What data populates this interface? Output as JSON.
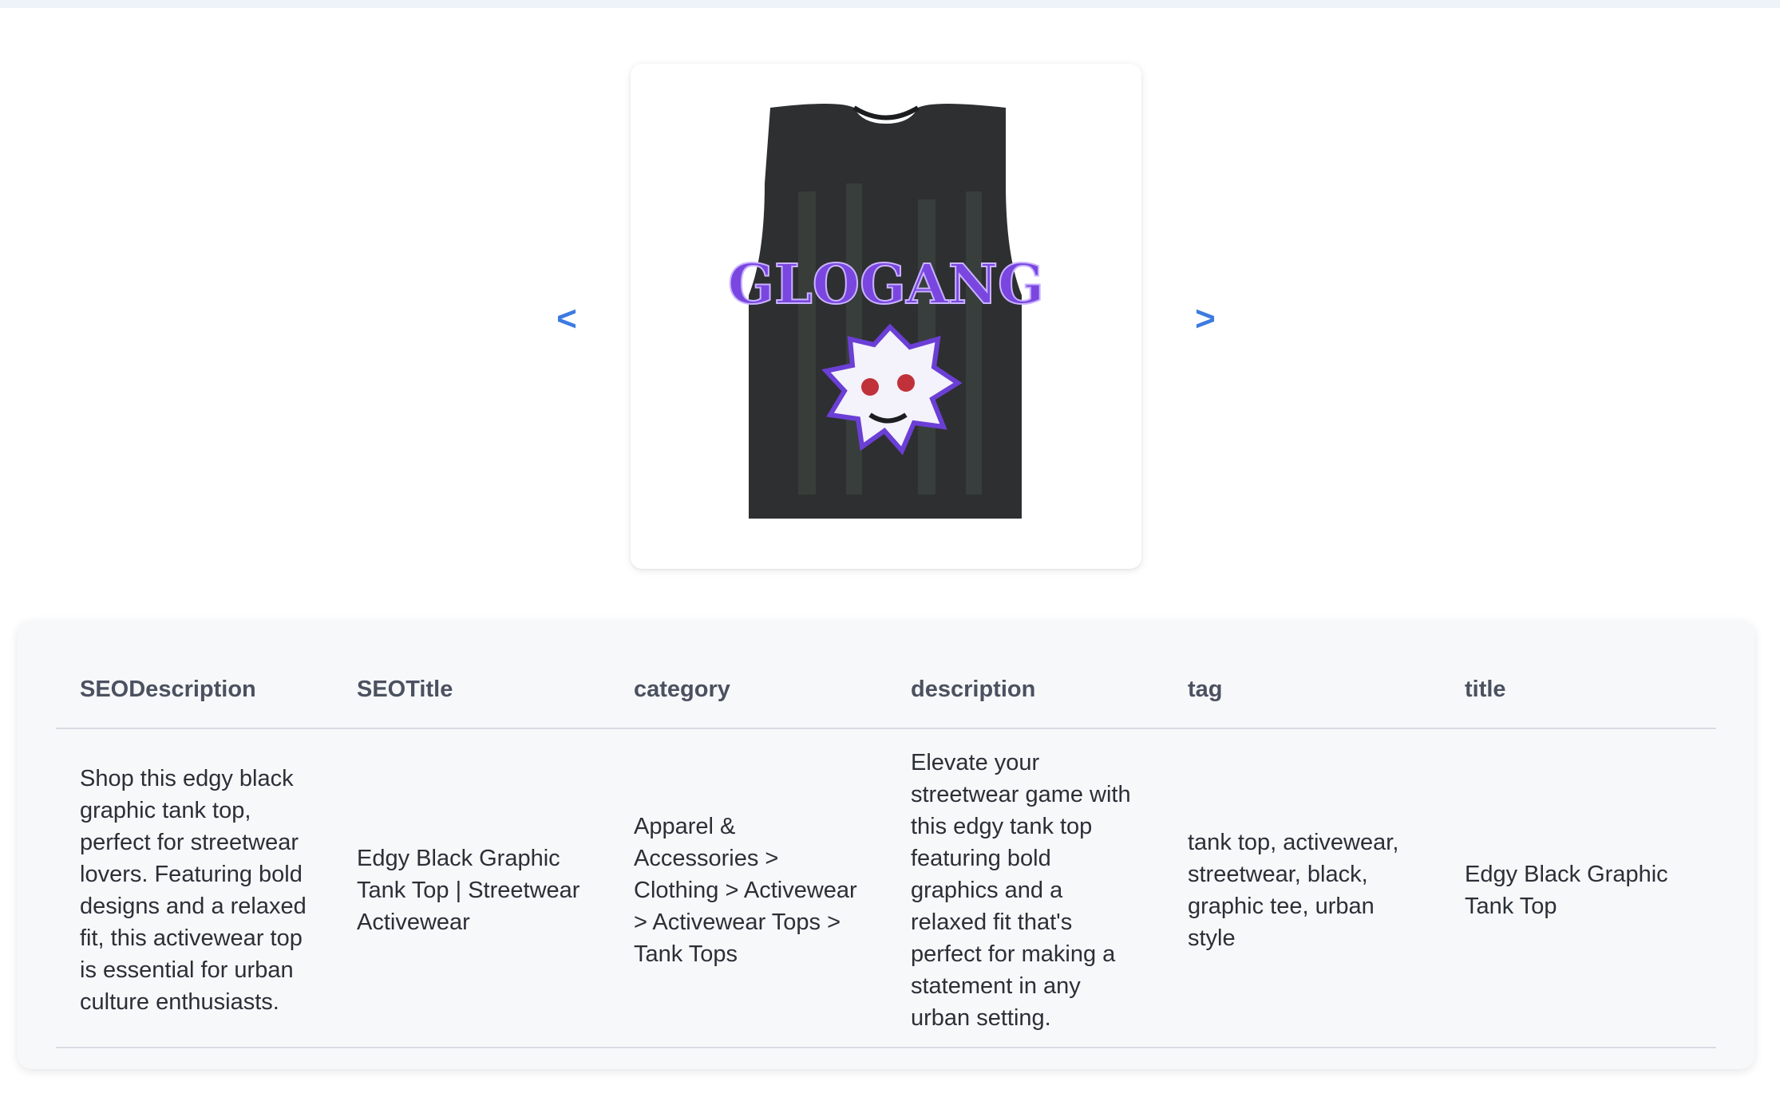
{
  "nav": {
    "prev_label": "<",
    "next_label": ">"
  },
  "product_image": {
    "alt": "Black graphic tank top"
  },
  "table": {
    "headers": [
      "SEODescription",
      "SEOTitle",
      "category",
      "description",
      "tag",
      "title"
    ],
    "rows": [
      [
        "Shop this edgy black graphic tank top, perfect for streetwear lovers. Featuring bold designs and a relaxed fit, this activewear top is essential for urban culture enthusiasts.",
        "Edgy Black Graphic Tank Top | Streetwear Activewear",
        "Apparel & Accessories > Clothing > Activewear > Activewear Tops > Tank Tops",
        "Elevate your streetwear game with this edgy tank top featuring bold graphics and a relaxed fit that's perfect for making a statement in any urban setting.",
        "tank top, activewear, streetwear, black, graphic tee, urban style",
        "Edgy Black Graphic Tank Top"
      ]
    ]
  },
  "colors": {
    "accent": "#3d7be0",
    "card_bg": "#f7f8fa",
    "shirt": "#2e2f31",
    "graphic": "#8b5cf6"
  }
}
